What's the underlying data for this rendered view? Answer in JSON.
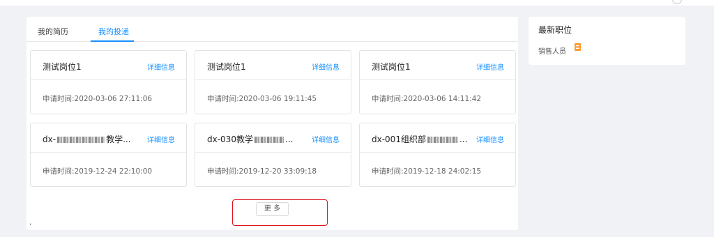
{
  "tabs": [
    {
      "label": "我的简历"
    },
    {
      "label": "我的投递"
    }
  ],
  "applications": [
    {
      "title": "测试岗位1",
      "link": "详细信息",
      "time": "申请时间:2020-03-06 27:11:06"
    },
    {
      "title": "测试岗位1",
      "link": "详细信息",
      "time": "申请时间:2020-03-06 19:11:45"
    },
    {
      "title": "测试岗位1",
      "link": "详细信息",
      "time": "申请时间:2020-03-06 14:11:42"
    },
    {
      "title_prefix": "dx-",
      "title_suffix": "教学...",
      "link": "详细信息",
      "time": "申请时间:2019-12-24 22:10:00"
    },
    {
      "title_prefix": "dx-030教学",
      "title_suffix": "...",
      "link": "详细信息",
      "time": "申请时间:2019-12-20 33:09:18"
    },
    {
      "title_prefix": "dx-001组织部",
      "title_suffix": "...",
      "link": "详细信息",
      "time": "申请时间:2019-12-18 24:02:15"
    }
  ],
  "more_button": "更 多",
  "stray_mark": ",",
  "latest_jobs": {
    "title": "最新职位",
    "items": [
      {
        "label": "销售人员",
        "icon": "document-icon",
        "icon_color": "#ff9a2e"
      }
    ]
  },
  "colors": {
    "accent": "#1890ff",
    "highlight": "#e0141e",
    "background": "#f0f2f5"
  }
}
